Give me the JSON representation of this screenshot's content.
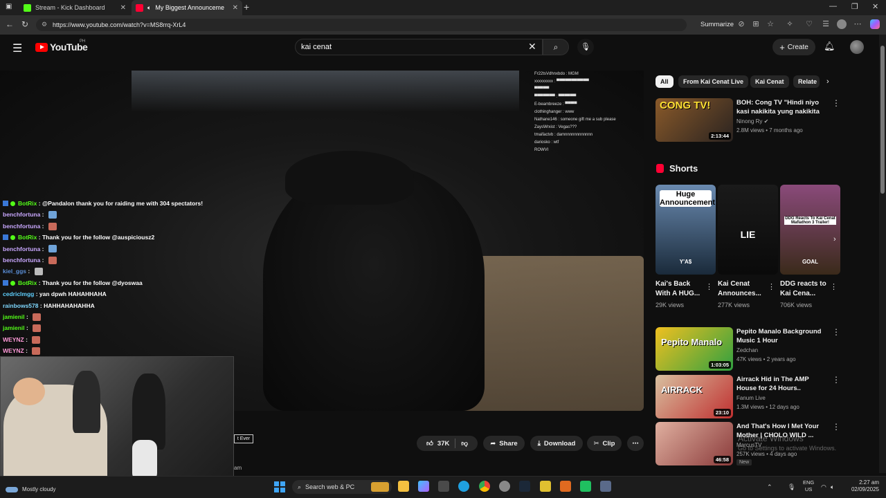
{
  "browser": {
    "tabs": [
      {
        "title": "Stream - Kick Dashboard",
        "color": "#53fc18"
      },
      {
        "title": "My Biggest Announcement Ever",
        "color": "#ff0033"
      }
    ],
    "url": "https://www.youtube.com/watch?v=MS8rrq-XrL4",
    "summarize_label": "Summarize"
  },
  "header": {
    "logo_text": "YouTube",
    "country": "PH",
    "search_value": "kai cenat",
    "create_label": "Create"
  },
  "player": {
    "caption_chip": "t Ever",
    "subtext": "am",
    "chat_right": [
      "Fr22tsVdhnxbdo : MGM",
      "xxxxxxxxx : ▀▀▀▀▀▀▀▀▀▀▀",
      "▀▀▀▀▀",
      "▀▀▀▀▀▀▀ : ▀▀▀▀▀▀",
      "E-beambreeze : ▀▀▀▀",
      "clothinghanger : www",
      "Nathane146 : someone gift me a sub please",
      "ZaysWrxist : Vegas???",
      "tmaifactvb : damnnnnnnnnnnnn",
      "dariosko : wtf",
      "ROWVI"
    ],
    "chat_left": [
      {
        "user": "BotRix",
        "color": "#53fc18",
        "bot": true,
        "msg": "@Pandalon thank you for raiding me with 304 spectators!"
      },
      {
        "user": "benchfortuna",
        "color": "#c9a8ff",
        "bot": false,
        "msg": "",
        "emote": "#6fa3d8"
      },
      {
        "user": "benchfortuna",
        "color": "#c9a8ff",
        "bot": false,
        "msg": "",
        "emote": "#c86a5a"
      },
      {
        "user": "BotRix",
        "color": "#53fc18",
        "bot": true,
        "msg": "Thank you for the follow @auspiciousz2"
      },
      {
        "user": "benchfortuna",
        "color": "#c9a8ff",
        "bot": false,
        "msg": "",
        "emote": "#6fa3d8"
      },
      {
        "user": "benchfortuna",
        "color": "#c9a8ff",
        "bot": false,
        "msg": "",
        "emote": "#c86a5a"
      },
      {
        "user": "kiel_ggs",
        "color": "#5b8fd8",
        "bot": false,
        "msg": "",
        "emote": "#bbbbbb"
      },
      {
        "user": "BotRix",
        "color": "#53fc18",
        "bot": true,
        "msg": "Thank you for the follow @dyoswaa"
      },
      {
        "user": "cedriclmgg",
        "color": "#5fd0ff",
        "bot": false,
        "msg": "yan dpwh HAHAHHAHA"
      },
      {
        "user": "rainbows578",
        "color": "#7fd8ff",
        "bot": false,
        "msg": "HAHHAHAHAHHA"
      },
      {
        "user": "jamienil",
        "color": "#53fc18",
        "bot": false,
        "msg": "",
        "emote": "#c86a5a"
      },
      {
        "user": "jamienil",
        "color": "#53fc18",
        "bot": false,
        "msg": "",
        "emote": "#c86a5a"
      },
      {
        "user": "WEYNZ",
        "color": "#ff9ad8",
        "bot": false,
        "msg": "",
        "emote": "#c86a5a"
      },
      {
        "user": "WEYNZ",
        "color": "#ff9ad8",
        "bot": false,
        "msg": "",
        "emote": "#c86a5a"
      }
    ]
  },
  "actions": {
    "likes": "37K",
    "share": "Share",
    "download": "Download",
    "clip": "Clip"
  },
  "chips": [
    "All",
    "From Kai Cenat Live",
    "Kai Cenat",
    "Relate"
  ],
  "videos_top": [
    {
      "title": "BOH: Cong TV \"Hindi niyo kasi nakikita yung nakikita ko.\" | ...",
      "channel": "Ninong Ry",
      "meta": "2.8M views • 7 months ago",
      "duration": "2:13:44",
      "thumb_label": "CONG TV!",
      "thumb_colors": [
        "#8a5a2a",
        "#2a2320"
      ]
    }
  ],
  "shorts": {
    "heading": "Shorts",
    "items": [
      {
        "title": "Kai's Back With A HUG...",
        "views": "29K views",
        "overlay": "Huge Announcement",
        "bottom": "Y'A$",
        "bg": [
          "#6a8ab0",
          "#1a2a3a"
        ]
      },
      {
        "title": "Kai Cenat Announces...",
        "views": "277K views",
        "overlay": "LIE",
        "bottom": "",
        "bg": [
          "#1a1a1a",
          "#0a0a0a"
        ]
      },
      {
        "title": "DDG reacts to Kai Cena...",
        "views": "706K views",
        "overlay": "DDG Reacts To Kai Cenat Mafiathon 3 Trailer!",
        "bottom": "GOAL",
        "bg": [
          "#8a4a7a",
          "#3a2a1a"
        ]
      }
    ]
  },
  "videos": [
    {
      "title": "Pepito Manalo Background Music 1 Hour",
      "channel": "Zedchan",
      "meta": "47K views • 2 years ago",
      "duration": "1:03:05",
      "thumb_label": "Pepito Manalo",
      "thumb_colors": [
        "#f0c020",
        "#30a040"
      ],
      "badge": ""
    },
    {
      "title": "Airrack Hid in The AMP House for 24 Hours..",
      "channel": "Fanum Live",
      "meta": "1.3M views • 12 days ago",
      "duration": "23:10",
      "thumb_label": "AIRRACK",
      "thumb_colors": [
        "#d8c0a0",
        "#c03030"
      ],
      "badge": ""
    },
    {
      "title": "And That's How I Met Your Mother | CHOLO WILD ...",
      "channel": "MarcusTV",
      "meta": "257K views • 4 days ago",
      "duration": "46:58",
      "thumb_label": "",
      "thumb_colors": [
        "#e0b0a0",
        "#8a3a3a"
      ],
      "badge": "New"
    }
  ],
  "watermark": {
    "line1": "Activate Windows",
    "line2": "Go to Settings to activate Windows."
  },
  "taskbar": {
    "weather": "Mostly cloudy",
    "search_placeholder": "Search web & PC",
    "lang1": "ENG",
    "lang2": "US",
    "time": "2:27 am",
    "date": "02/09/2025"
  }
}
